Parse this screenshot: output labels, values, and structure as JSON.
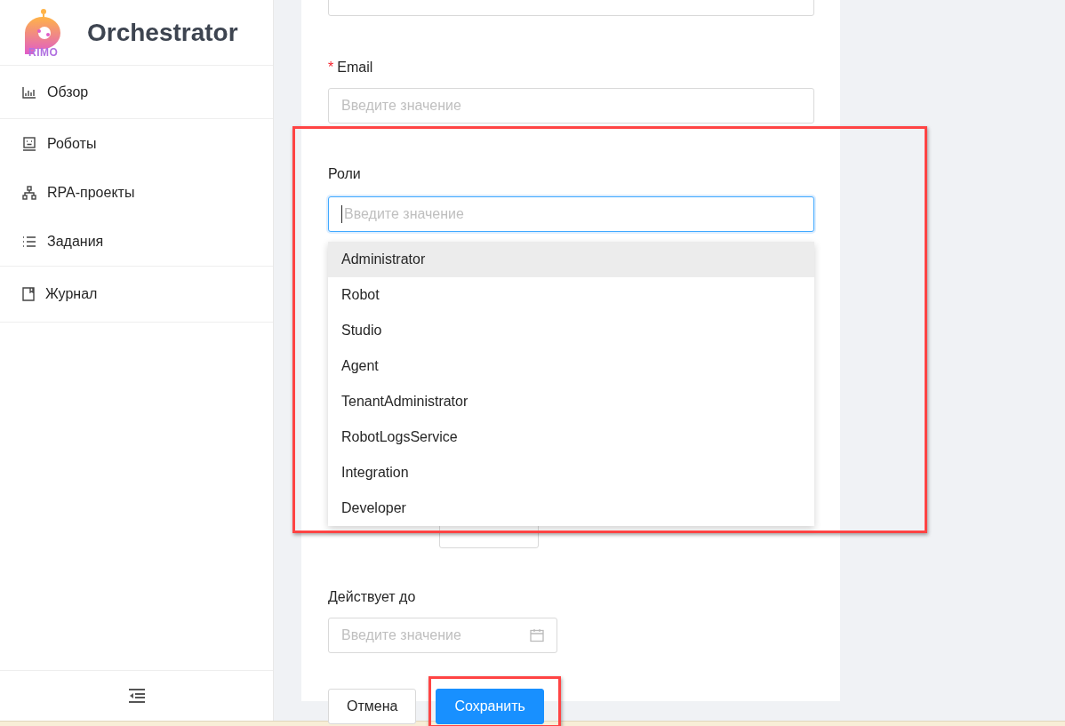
{
  "app": {
    "title": "Orchestrator",
    "logo_text": "RIMO"
  },
  "menu_groups": [
    [
      {
        "kind": "chart",
        "label": "Обзор"
      }
    ],
    [
      {
        "kind": "robot",
        "label": "Роботы"
      },
      {
        "kind": "hierarchy",
        "label": "RPA-проекты"
      },
      {
        "kind": "list",
        "label": "Задания"
      }
    ],
    [
      {
        "kind": "book",
        "label": "Журнал"
      }
    ]
  ],
  "form": {
    "email": {
      "marker": "*",
      "label": "Email",
      "placeholder": "Введите значение"
    },
    "roles": {
      "label": "Роли",
      "placeholder": "Введите значение",
      "focused": true,
      "highlighted": true,
      "options": [
        {
          "label": "Administrator",
          "active": true
        },
        {
          "label": "Robot",
          "active": false
        },
        {
          "label": "Studio",
          "active": false
        },
        {
          "label": "Agent",
          "active": false
        },
        {
          "label": "TenantAdministrator",
          "active": false
        },
        {
          "label": "RobotLogsService",
          "active": false
        },
        {
          "label": "Integration",
          "active": false
        },
        {
          "label": "Developer",
          "active": false
        }
      ]
    },
    "valid_until": {
      "label": "Действует до",
      "placeholder": "Введите значение"
    },
    "buttons": [
      {
        "kind": "default",
        "label": "Отмена",
        "highlighted": false
      },
      {
        "kind": "primary",
        "label": "Сохранить",
        "highlighted": true
      }
    ]
  }
}
